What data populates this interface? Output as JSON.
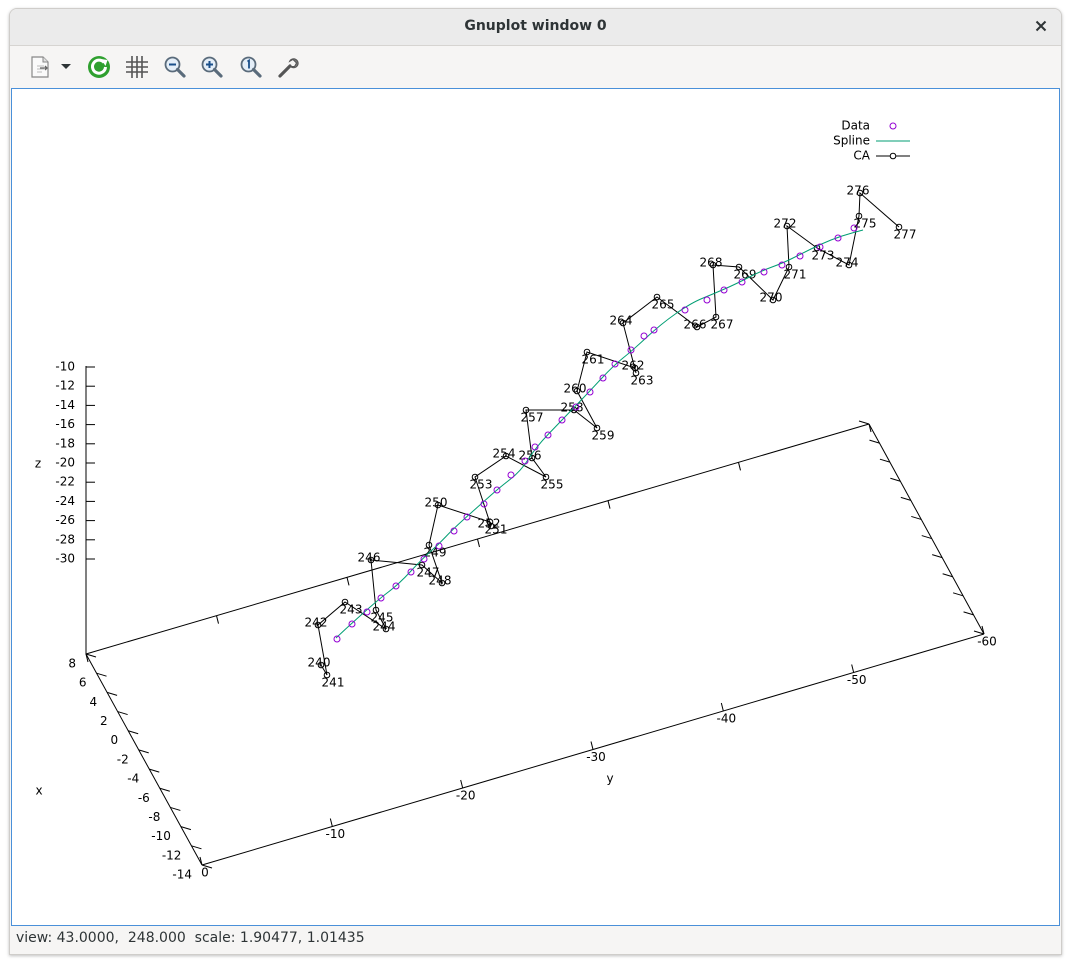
{
  "window": {
    "title": "Gnuplot window 0"
  },
  "toolbar": {
    "items": [
      {
        "name": "export",
        "icon": "document-export-icon"
      },
      {
        "name": "export-menu",
        "icon": "chevron-down-icon"
      },
      {
        "name": "replot",
        "icon": "refresh-icon"
      },
      {
        "name": "grid",
        "icon": "grid-icon"
      },
      {
        "name": "zoom-out",
        "icon": "zoom-out-icon"
      },
      {
        "name": "zoom-in",
        "icon": "zoom-in-icon"
      },
      {
        "name": "zoom-reset",
        "icon": "zoom-original-icon"
      },
      {
        "name": "settings",
        "icon": "wrench-icon"
      }
    ]
  },
  "status": {
    "text": "view: 43.0000,  248.000  scale: 1.90477, 1.01435"
  },
  "chart_data": {
    "type": "scatter",
    "axes": {
      "x": {
        "label": "x",
        "ticks": [
          "8",
          "6",
          "4",
          "2",
          "0",
          "-2",
          "-4",
          "-6",
          "-8",
          "-10",
          "-12",
          "-14"
        ]
      },
      "y": {
        "label": "y",
        "ticks": [
          "0",
          "-10",
          "-20",
          "-30",
          "-40",
          "-50",
          "-60"
        ]
      },
      "z": {
        "label": "z",
        "ticks": [
          "-10",
          "-12",
          "-14",
          "-16",
          "-18",
          "-20",
          "-22",
          "-24",
          "-26",
          "-28",
          "-30"
        ]
      }
    },
    "legend": {
      "placement": "top-right",
      "entries": [
        {
          "label": "Data",
          "style": "points",
          "color": "#9400d3"
        },
        {
          "label": "Spline",
          "style": "line",
          "color": "#009e73"
        },
        {
          "label": "CA",
          "style": "linespoints",
          "color": "#000000"
        }
      ]
    },
    "ca_residues": [
      "240",
      "241",
      "242",
      "243",
      "244",
      "245",
      "246",
      "247",
      "248",
      "249",
      "250",
      "251",
      "252",
      "253",
      "254",
      "255",
      "256",
      "257",
      "258",
      "259",
      "260",
      "261",
      "262",
      "263",
      "264",
      "265",
      "266",
      "267",
      "268",
      "269",
      "270",
      "271",
      "272",
      "273",
      "274",
      "275",
      "276",
      "277"
    ],
    "colors": {
      "data": "#9400d3",
      "spline": "#009e73",
      "ca": "#000000",
      "axis": "#000000"
    }
  }
}
